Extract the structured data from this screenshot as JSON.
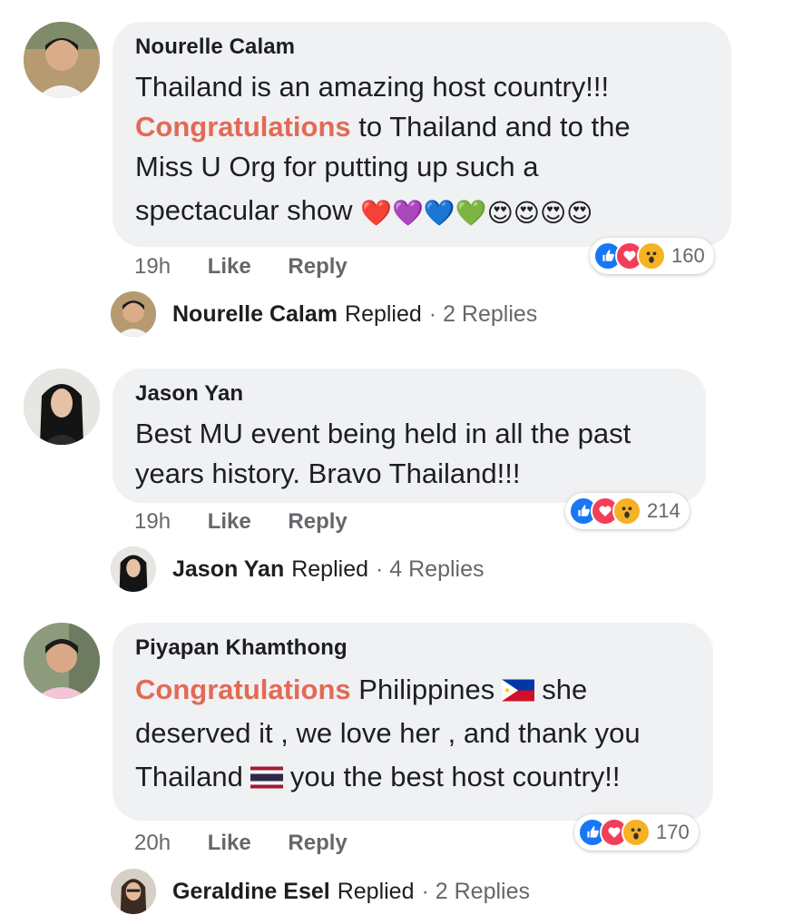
{
  "comments": [
    {
      "author": "Nourelle Calam",
      "text_line1": "Thailand is an amazing host country!!!",
      "highlight": "Congratulations",
      "text_line2_rest": " to Thailand and to the",
      "text_line3": "Miss U Org for putting up such a",
      "text_line4": "spectacular show",
      "emojis": "❤️💜💙💚😍😍😍😍",
      "time": "19h",
      "like": "Like",
      "reply": "Reply",
      "reaction_count": "160",
      "replied_name": "Nourelle Calam",
      "replied_verb": "Replied",
      "replied_count": "· 2 Replies"
    },
    {
      "author": "Jason Yan",
      "text_line1": "Best MU event being held in all the past",
      "text_line2": "years history. Bravo Thailand!!!",
      "time": "19h",
      "like": "Like",
      "reply": "Reply",
      "reaction_count": "214",
      "replied_name": "Jason Yan",
      "replied_verb": "Replied",
      "replied_count": "· 4 Replies"
    },
    {
      "author": "Piyapan Khamthong",
      "highlight": "Congratulations",
      "text_line1_rest": " Philippines",
      "text_line1_end": "she",
      "text_line2": "deserved it , we love her , and thank you",
      "text_line3_start": "Thailand",
      "text_line3_end": "you the best host country!!",
      "time": "20h",
      "like": "Like",
      "reply": "Reply",
      "reaction_count": "170",
      "replied_name": "Geraldine Esel",
      "replied_verb": "Replied",
      "replied_count": "· 2 Replies"
    }
  ],
  "icons": {
    "like": "like-reaction-icon",
    "love": "love-reaction-icon",
    "wow": "wow-reaction-icon",
    "flag_ph": "philippines-flag-icon",
    "flag_th": "thailand-flag-icon"
  },
  "colors": {
    "bubble": "#f0f1f3",
    "highlight": "#e26a55",
    "like": "#1877f2",
    "love": "#f33e58",
    "wow": "#f7b125"
  }
}
